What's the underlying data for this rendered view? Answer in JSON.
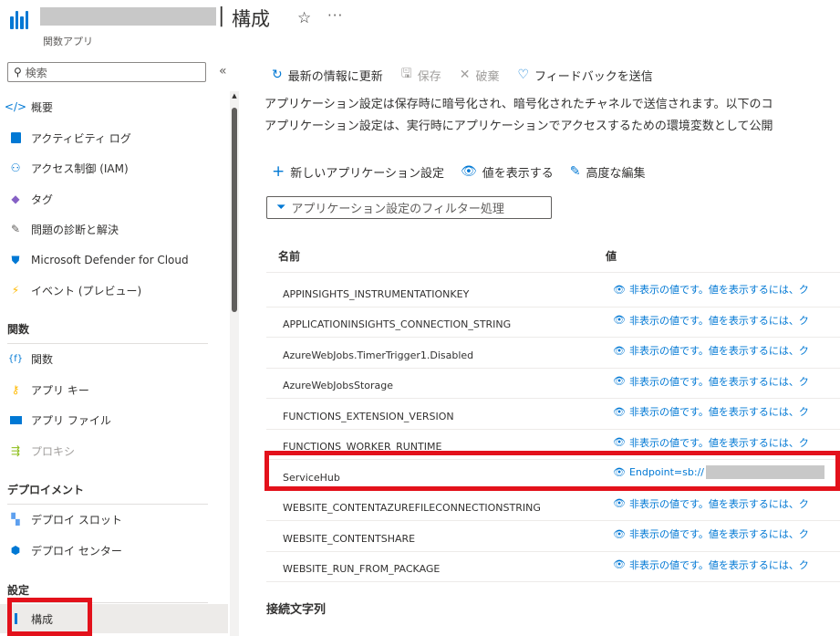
{
  "header": {
    "title_separator": "|",
    "title": "構成",
    "subtitle": "関数アプリ",
    "star_glyph": "☆",
    "more_glyph": "···"
  },
  "sidebar": {
    "search_placeholder": "検索",
    "collapse_glyph": "«",
    "items_top": [
      {
        "label": "概要",
        "icon": "overview-icon"
      },
      {
        "label": "アクティビティ ログ",
        "icon": "activity-log-icon"
      },
      {
        "label": "アクセス制御 (IAM)",
        "icon": "iam-icon"
      },
      {
        "label": "タグ",
        "icon": "tag-icon"
      },
      {
        "label": "問題の診断と解決",
        "icon": "diagnose-icon"
      },
      {
        "label": "Microsoft Defender for Cloud",
        "icon": "defender-icon"
      },
      {
        "label": "イベント (プレビュー)",
        "icon": "events-icon"
      }
    ],
    "section_functions": "関数",
    "items_functions": [
      {
        "label": "関数",
        "icon": "function-icon"
      },
      {
        "label": "アプリ キー",
        "icon": "key-icon"
      },
      {
        "label": "アプリ ファイル",
        "icon": "app-files-icon"
      },
      {
        "label": "プロキシ",
        "icon": "proxy-icon"
      }
    ],
    "section_deployment": "デプロイメント",
    "items_deployment": [
      {
        "label": "デプロイ スロット",
        "icon": "deployment-slots-icon"
      },
      {
        "label": "デプロイ センター",
        "icon": "deployment-center-icon"
      }
    ],
    "section_settings": "設定",
    "items_settings": [
      {
        "label": "構成",
        "icon": "configuration-icon"
      }
    ]
  },
  "toolbar": {
    "refresh": "最新の情報に更新",
    "save": "保存",
    "discard": "破棄",
    "feedback": "フィードバックを送信"
  },
  "description": {
    "line1": "アプリケーション設定は保存時に暗号化され、暗号化されたチャネルで送信されます。以下のコ",
    "line2": "アプリケーション設定は、実行時にアプリケーションでアクセスするための環境変数として公開"
  },
  "actions": {
    "new_setting": "新しいアプリケーション設定",
    "show_values": "値を表示する",
    "advanced_edit": "高度な編集"
  },
  "filter": {
    "placeholder": "アプリケーション設定のフィルター処理"
  },
  "table": {
    "col_name": "名前",
    "col_value": "値",
    "hidden_value_text": "非表示の値です。値を表示するには、ク",
    "rows": [
      {
        "name": "APPINSIGHTS_INSTRUMENTATIONKEY",
        "value": "非表示の値です。値を表示するには、ク"
      },
      {
        "name": "APPLICATIONINSIGHTS_CONNECTION_STRING",
        "value": "非表示の値です。値を表示するには、ク"
      },
      {
        "name": "AzureWebJobs.TimerTrigger1.Disabled",
        "value": "非表示の値です。値を表示するには、ク"
      },
      {
        "name": "AzureWebJobsStorage",
        "value": "非表示の値です。値を表示するには、ク"
      },
      {
        "name": "FUNCTIONS_EXTENSION_VERSION",
        "value": "非表示の値です。値を表示するには、ク"
      },
      {
        "name": "FUNCTIONS_WORKER_RUNTIME",
        "value": "非表示の値です。値を表示するには、ク"
      },
      {
        "name": "ServiceHub",
        "value": "Endpoint=sb://"
      },
      {
        "name": "WEBSITE_CONTENTAZUREFILECONNECTIONSTRING",
        "value": "非表示の値です。値を表示するには、ク"
      },
      {
        "name": "WEBSITE_CONTENTSHARE",
        "value": "非表示の値です。値を表示するには、ク"
      },
      {
        "name": "WEBSITE_RUN_FROM_PACKAGE",
        "value": "非表示の値です。値を表示するには、ク"
      }
    ]
  },
  "connection_strings_header": "接続文字列",
  "colors": {
    "accent": "#0078d4",
    "highlight": "#e3111b"
  }
}
